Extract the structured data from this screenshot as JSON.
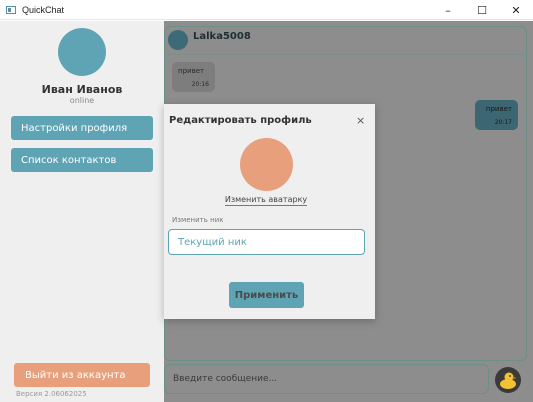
{
  "window": {
    "title": "QuickChat",
    "minimize_glyph": "–",
    "maximize_glyph": "☐",
    "close_glyph": "✕"
  },
  "sidebar": {
    "user_name": "Иван Иванов",
    "status": "online",
    "profile_settings_label": "Настройки профиля",
    "contacts_label": "Список контактов",
    "logout_label": "Выйти из аккаунта",
    "version": "Версия 2.06062025"
  },
  "chat": {
    "contact_name": "Lalka5008",
    "messages": [
      {
        "direction": "incoming",
        "text": "привет",
        "time": "20:16"
      },
      {
        "direction": "outgoing",
        "text": "привет",
        "time": "20:17"
      }
    ],
    "input_placeholder": "Введите сообщение..."
  },
  "modal": {
    "title": "Редактировать профиль",
    "close_glyph": "×",
    "change_avatar_label": "Изменить аватарку",
    "nick_label": "Изменить ник",
    "nick_placeholder": "Текущий ник",
    "apply_label": "Применить"
  },
  "icons": {
    "send": "duck-icon"
  },
  "colors": {
    "accent_teal": "#5fa4b5",
    "accent_orange": "#e8a07c",
    "overlay_gray": "#8d8d8d"
  }
}
